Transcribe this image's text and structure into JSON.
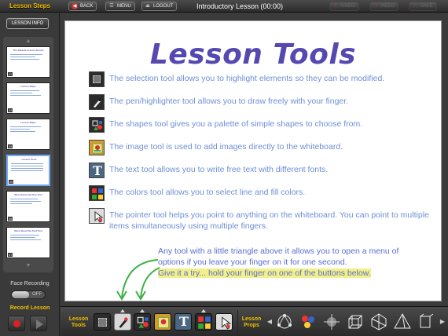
{
  "topbar": {
    "steps_title": "Lesson Steps",
    "back_label": "BACK",
    "menu_label": "MENU",
    "logout_label": "LOGOUT",
    "title": "Introductory Lesson (00:00)",
    "undo_label": "UNDO",
    "redo_label": "REDO",
    "save_label": "SAVE"
  },
  "sidebar": {
    "info_label": "LESSON INFO",
    "thumbs": [
      {
        "title": "The Saved Lessons Screen",
        "num": "01"
      },
      {
        "title": "Lesson Steps",
        "num": "03"
      },
      {
        "title": "Lesson Steps",
        "num": "04"
      },
      {
        "title": "Lesson Tools",
        "num": "05"
      },
      {
        "title": "More About the Pen Tool",
        "num": "06"
      },
      {
        "title": "More About the Text Tool",
        "num": "07"
      }
    ],
    "face_label": "Face Recording",
    "toggle_label": "OFF",
    "record_label": "Record Lesson"
  },
  "board": {
    "heading": "Lesson Tools",
    "tools": [
      {
        "icon": "selection-tool-icon",
        "text": "The selection tool allows you to highlight elements so they can be modified."
      },
      {
        "icon": "pen-tool-icon",
        "text": "The pen/highlighter tool allows you to draw freely with your finger."
      },
      {
        "icon": "shapes-tool-icon",
        "text": "The shapes tool gives you a palette of simple shapes to choose from."
      },
      {
        "icon": "image-tool-icon",
        "text": "The image tool is used to add images directly to the whiteboard."
      },
      {
        "icon": "text-tool-icon",
        "text": "The text tool allows you to write free text with different fonts."
      },
      {
        "icon": "colors-tool-icon",
        "text": "The colors tool allows you to select line and fill colors."
      },
      {
        "icon": "pointer-tool-icon",
        "text": "The pointer tool helps you point to anything on the whiteboard. You can point to multiple items simultaneously using multiple fingers."
      }
    ],
    "note_line1": "Any tool with a little triangle above it allows you to open a menu of options if you leave your finger on it for one second.",
    "note_line2": "Give it a try... hold your finger on one of the buttons below."
  },
  "bottombar": {
    "tools_label_1": "Lesson",
    "tools_label_2": "Tools",
    "props_label_1": "Lesson",
    "props_label_2": "Props"
  },
  "colors": {
    "accent": "#f0c000",
    "heading": "#5548b0",
    "body_text": "#6d8fd6",
    "highlight": "#f2f08a",
    "selected_thumb": "#6fa8ff"
  }
}
